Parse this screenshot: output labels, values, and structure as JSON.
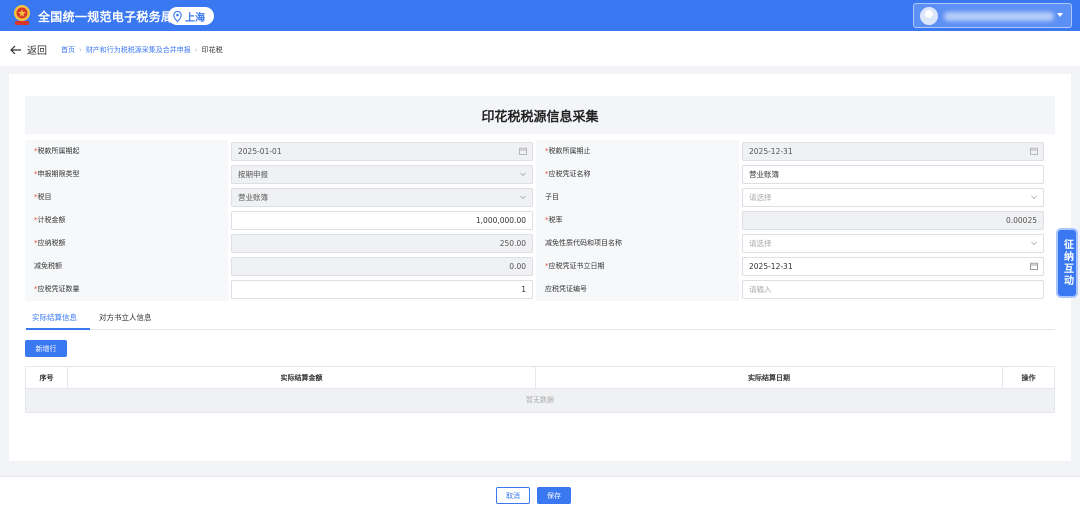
{
  "header": {
    "app_title": "全国统一规范电子税务局",
    "region": "上海"
  },
  "nav": {
    "back_label": "返回",
    "breadcrumb": [
      "首页",
      "财产和行为税税源采集及合并申报",
      "印花税"
    ]
  },
  "form": {
    "title": "印花税税源信息采集",
    "fields": {
      "period_start": {
        "label": "税款所属期起",
        "value": "2025-01-01"
      },
      "period_end": {
        "label": "税款所属期止",
        "value": "2025-12-31"
      },
      "period_type": {
        "label": "申报期限类型",
        "value": "按期申报"
      },
      "voucher_name": {
        "label": "应税凭证名称",
        "value": "营业账簿"
      },
      "tax_item": {
        "label": "税目",
        "value": "营业账簿"
      },
      "sub_item": {
        "label": "子目",
        "placeholder": "请选择"
      },
      "taxable_amount": {
        "label": "计税金额",
        "value": "1,000,000.00"
      },
      "tax_rate": {
        "label": "税率",
        "value": "0.00025"
      },
      "tax_payable": {
        "label": "应纳税额",
        "value": "250.00"
      },
      "exemption_code": {
        "label": "减免性质代码和项目名称",
        "placeholder": "请选择"
      },
      "tax_reduction": {
        "label": "减免税额",
        "value": "0.00"
      },
      "voucher_date": {
        "label": "应税凭证书立日期",
        "value": "2025-12-31"
      },
      "voucher_count": {
        "label": "应税凭证数量",
        "value": "1"
      },
      "voucher_number": {
        "label": "应税凭证编号",
        "placeholder": "请输入"
      }
    }
  },
  "tabs": [
    {
      "label": "实际结算信息",
      "active": true
    },
    {
      "label": "对方书立人信息",
      "active": false
    }
  ],
  "table": {
    "add_label": "新增行",
    "columns": [
      "序号",
      "实际结算金额",
      "实际结算日期",
      "操作"
    ],
    "empty_text": "暂无数据"
  },
  "float_label": "征纳互动",
  "footer": {
    "cancel_label": "取消",
    "save_label": "保存"
  },
  "colors": {
    "primary": "#3a78f2",
    "required": "#e74c3c"
  }
}
